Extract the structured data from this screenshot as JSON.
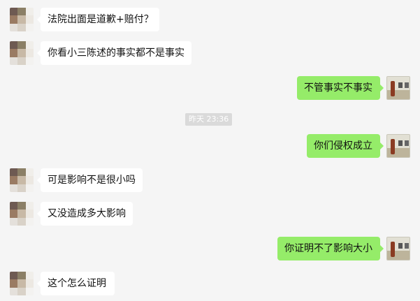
{
  "messages": [
    {
      "side": "in",
      "text": "法院出面是道歉+赔付？"
    },
    {
      "side": "in",
      "text": "你看小三陈述的事实都不是事实"
    },
    {
      "side": "out",
      "text": "不管事实不事实"
    },
    {
      "side": "out",
      "text": "你们侵权成立"
    },
    {
      "side": "in",
      "text": "可是影响不是很小吗"
    },
    {
      "side": "in",
      "text": "又没造成多大影响"
    },
    {
      "side": "out",
      "text": "你证明不了影响大小"
    },
    {
      "side": "in",
      "text": "这个怎么证明"
    }
  ],
  "timestamp": "昨天 23:36",
  "colors": {
    "incoming_bubble": "#ffffff",
    "outgoing_bubble": "#95ec69",
    "background": "#f5f5f5"
  },
  "icons": {
    "contact_avatar": "pixelated-avatar",
    "self_avatar": "gallery-photo-avatar"
  }
}
